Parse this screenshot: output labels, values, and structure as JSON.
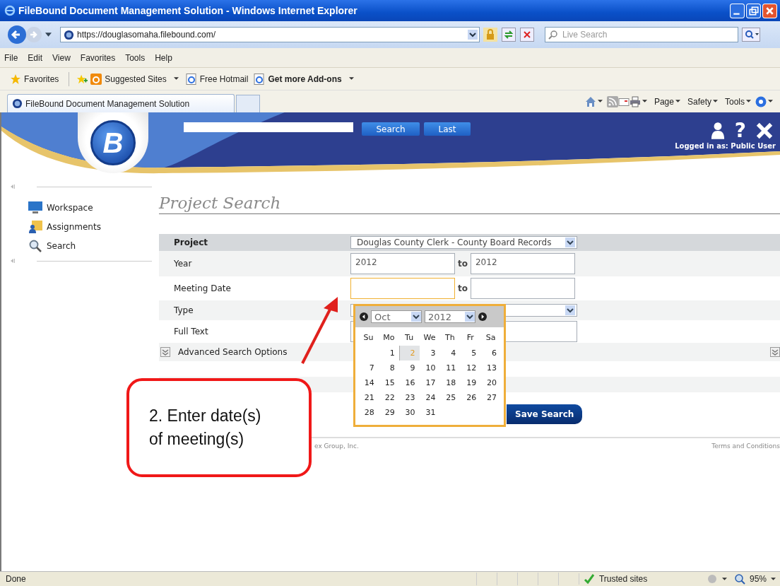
{
  "window": {
    "title": "FileBound Document Management Solution - Windows Internet Explorer"
  },
  "address_bar": {
    "url": "https://douglasomaha.filebound.com/"
  },
  "search_box": {
    "placeholder": "Live Search"
  },
  "menu": [
    "File",
    "Edit",
    "View",
    "Favorites",
    "Tools",
    "Help"
  ],
  "favorites_bar": {
    "favorites": "Favorites",
    "links": [
      {
        "label": "Suggested Sites",
        "dropdown": true,
        "bold": false
      },
      {
        "label": "Free Hotmail",
        "dropdown": false,
        "bold": false
      },
      {
        "label": "Get more Add-ons",
        "dropdown": true,
        "bold": true
      }
    ]
  },
  "tabs": [
    {
      "label": "FileBound Document Management Solution",
      "selected": true
    }
  ],
  "command_bar": [
    "Page",
    "Safety",
    "Tools"
  ],
  "header": {
    "logo_letter": "B",
    "search_buttons": [
      "Search",
      "Last"
    ],
    "help": "?",
    "login": "Logged in as: Public User"
  },
  "sidebar": {
    "items": [
      {
        "label": "Workspace",
        "kind": "monitor"
      },
      {
        "label": "Assignments",
        "kind": "user"
      },
      {
        "label": "Search",
        "kind": "search"
      }
    ]
  },
  "page_title": "Project Search",
  "form": {
    "rows": [
      {
        "label": "Project",
        "kind": "select",
        "value": "Douglas County Clerk - County Board Records"
      },
      {
        "label": "Year",
        "kind": "range",
        "from": "2012",
        "to": "2012",
        "separator": "to",
        "focused": false
      },
      {
        "label": "Meeting Date",
        "kind": "range",
        "separator": "to",
        "focused": true
      },
      {
        "label": "Type",
        "kind": "select"
      },
      {
        "label": "Full Text",
        "kind": "text"
      }
    ]
  },
  "advanced": "Advanced Search Options",
  "buttons": [
    "Save Search"
  ],
  "calendar": {
    "month": "Oct",
    "year": "2012",
    "weekdays": [
      "Su",
      "Mo",
      "Tu",
      "We",
      "Th",
      "Fr",
      "Sa"
    ],
    "weeks": [
      {
        "days": [
          {
            "day": "1",
            "today": false
          },
          {
            "day": "2",
            "today": true
          },
          {
            "day": "3",
            "today": false
          },
          {
            "day": "4",
            "today": false
          },
          {
            "day": "5",
            "today": false
          },
          {
            "day": "6",
            "today": false
          }
        ]
      },
      {
        "days": [
          {
            "day": "7",
            "today": false
          },
          {
            "day": "8",
            "today": false
          },
          {
            "day": "9",
            "today": false
          },
          {
            "day": "10",
            "today": false
          },
          {
            "day": "11",
            "today": false
          },
          {
            "day": "12",
            "today": false
          },
          {
            "day": "13",
            "today": false
          }
        ]
      },
      {
        "days": [
          {
            "day": "14",
            "today": false
          },
          {
            "day": "15",
            "today": false
          },
          {
            "day": "16",
            "today": false
          },
          {
            "day": "17",
            "today": false
          },
          {
            "day": "18",
            "today": false
          },
          {
            "day": "19",
            "today": false
          },
          {
            "day": "20",
            "today": false
          }
        ]
      },
      {
        "days": [
          {
            "day": "21",
            "today": false
          },
          {
            "day": "22",
            "today": false
          },
          {
            "day": "23",
            "today": false
          },
          {
            "day": "24",
            "today": false
          },
          {
            "day": "25",
            "today": false
          },
          {
            "day": "26",
            "today": false
          },
          {
            "day": "27",
            "today": false
          }
        ]
      },
      {
        "days": [
          {
            "day": "28",
            "today": false
          },
          {
            "day": "29",
            "today": false
          },
          {
            "day": "30",
            "today": false
          },
          {
            "day": "31",
            "today": false
          }
        ]
      }
    ]
  },
  "callout": {
    "lines": [
      "2. Enter date(s)",
      "of meeting(s)"
    ]
  },
  "footer": {
    "copyright": "ex Group, Inc.",
    "terms": "Terms and Conditions"
  },
  "status_bar": {
    "status": "Done",
    "zone": "Trusted sites",
    "zoom": "95%"
  }
}
